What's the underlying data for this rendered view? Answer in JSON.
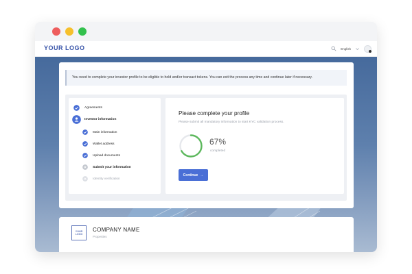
{
  "window": {
    "title_dots": [
      "close",
      "minimize",
      "maximize"
    ]
  },
  "appbar": {
    "logo": "YOUR LOGO",
    "language": "English",
    "icons": [
      "search-icon",
      "chevron-down-icon",
      "avatar"
    ]
  },
  "notice": {
    "text": "You need to complete your investor profile to be eligible to hold and/or transact tokens. You can exit the process any time and continue later if necessary."
  },
  "steps": [
    {
      "label": "Agreements",
      "status": "done"
    },
    {
      "label": "Investor information",
      "status": "current"
    },
    {
      "label": "Main information",
      "status": "done"
    },
    {
      "label": "Wallet address",
      "status": "done"
    },
    {
      "label": "Upload documents",
      "status": "done"
    },
    {
      "label": "Submit your information",
      "status": "pending"
    },
    {
      "label": "Identity verification",
      "status": "inactive"
    }
  ],
  "profile": {
    "title": "Please complete your profile",
    "subtitle": "Please submit all mandatory information to start KYC validation process.",
    "progress_value": 67,
    "progress_text": "67%",
    "progress_label": "completed",
    "continue_label": "Continue",
    "continue_arrow": "→"
  },
  "company": {
    "logo_line1": "YOUR",
    "logo_line2": "LOGO",
    "name": "COMPANY NAME",
    "subtitle": "Properties"
  },
  "colors": {
    "accent": "#4a6fd6",
    "logo": "#3753a8",
    "progress": "#5cb85c",
    "progress_track": "#e6e8ec",
    "step_done": "#4a6fd6",
    "step_pending": "#c4c8cf"
  }
}
